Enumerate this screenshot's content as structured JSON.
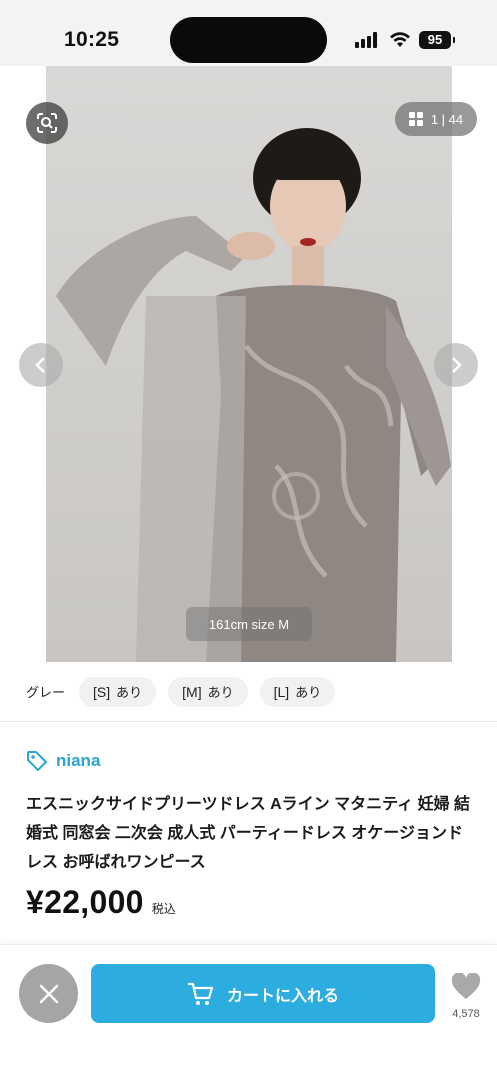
{
  "status_bar": {
    "time": "10:25",
    "battery": "95",
    "icons": [
      "signal-icon",
      "wifi-icon",
      "battery-icon"
    ]
  },
  "gallery": {
    "image_counter": "1 | 44",
    "model_caption": "161cm size M",
    "icons": [
      "image-search-icon",
      "grid-icon",
      "chevron-left-icon",
      "chevron-right-icon"
    ]
  },
  "variants": {
    "color": "グレー",
    "sizes": [
      {
        "size": "[S]",
        "stock": "あり"
      },
      {
        "size": "[M]",
        "stock": "あり"
      },
      {
        "size": "[L]",
        "stock": "あり"
      }
    ]
  },
  "product": {
    "brand": "niana",
    "title": "エスニックサイドプリーツドレス Aライン マタニティ 妊婦 結婚式 同窓会 二次会 成人式 パーティードレス オケージョンドレス お呼ばれワンピース",
    "price": "¥22,000",
    "tax_label": "税込"
  },
  "bottom_bar": {
    "cart_label": "カートに入れる",
    "favorite_count": "4,578",
    "icons": [
      "close-icon",
      "cart-icon",
      "heart-icon"
    ]
  },
  "colors": {
    "accent": "#2cacdf",
    "brand_text": "#2aa5cf",
    "close_button": "#a5a5a5"
  }
}
